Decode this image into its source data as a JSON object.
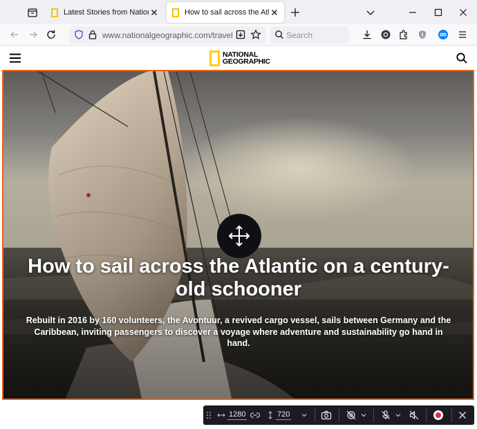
{
  "browser": {
    "tabs": [
      {
        "title": "Latest Stories from National Geographic",
        "active": false
      },
      {
        "title": "How to sail across the Atlantic on a century-old schooner",
        "active": true
      }
    ],
    "url": "www.nationalgeographic.com/travel/article/how-to-sail-across-the-atlantic",
    "search_placeholder": "Search"
  },
  "site": {
    "logo_line1": "NATIONAL",
    "logo_line2": "GEOGRAPHIC",
    "brand_color": "#ffce00"
  },
  "article": {
    "headline": "How to sail across the Atlantic on a century-old schooner",
    "dek": "Rebuilt in 2016 by 160 volunteers, the Avontuur, a revived cargo vessel, sails between Germany and the Caribbean, inviting passengers to discover a voyage where adventure and sustainability go hand in hand."
  },
  "responsive_toolbar": {
    "width": "1280",
    "height": "720"
  },
  "colors": {
    "selection_outline": "#e8621a",
    "toolbar_bg": "#1c1b22",
    "record": "#e22850"
  },
  "icons": [
    "tab-list-icon",
    "close-icon",
    "plus-icon",
    "chevron-down-icon",
    "minimize-icon",
    "maximize-icon",
    "back-icon",
    "forward-icon",
    "reload-icon",
    "shield-icon",
    "lock-icon",
    "reader-view-icon",
    "star-icon",
    "search-icon",
    "download-icon",
    "extension-icon",
    "account-icon",
    "menu-icon",
    "hamburger-icon",
    "move-icon",
    "drag-handle-icon",
    "width-icon",
    "link-icon",
    "height-icon",
    "camera-icon",
    "touch-off-icon",
    "mic-off-icon",
    "mute-icon",
    "record-icon"
  ]
}
